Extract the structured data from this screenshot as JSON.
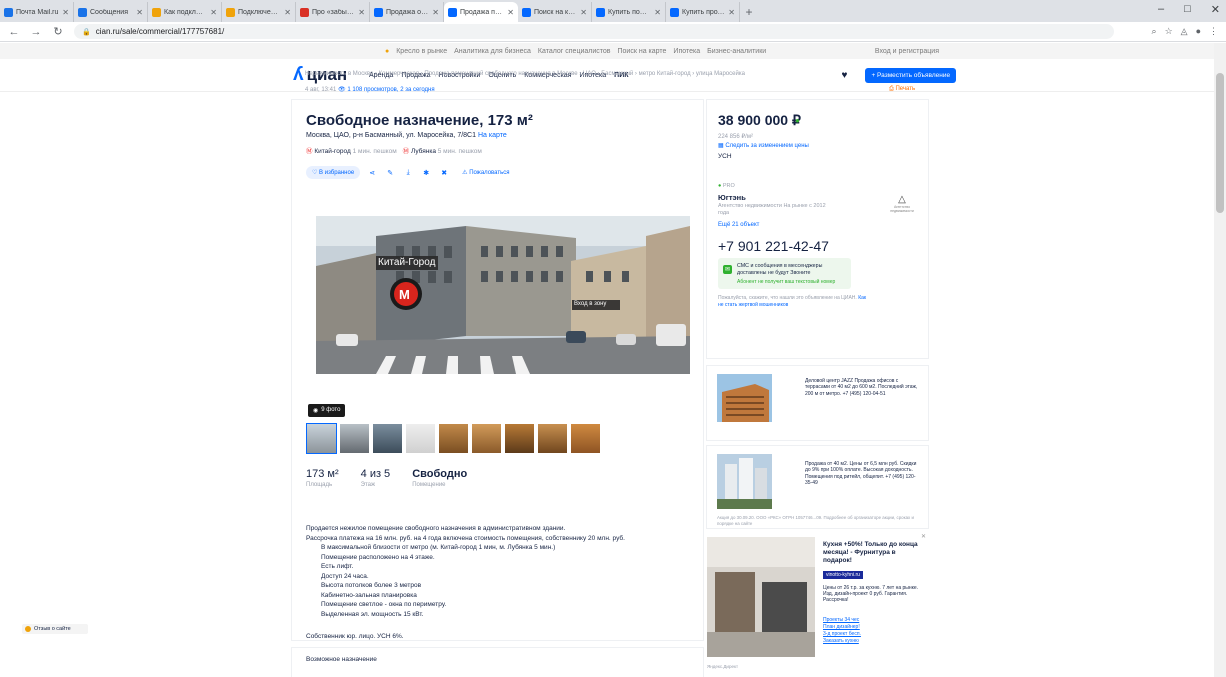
{
  "browser": {
    "tabs": [
      {
        "title": "Почта Mail.ru",
        "color": "#1a73e8"
      },
      {
        "title": "Сообщения",
        "color": "#1a73e8"
      },
      {
        "title": "Как подключить",
        "color": "#f0a30a"
      },
      {
        "title": "Подключение ком",
        "color": "#f0a30a"
      },
      {
        "title": "Про «забытый» на",
        "color": "#d93025"
      },
      {
        "title": "Продажа офиса 2",
        "color": "#0468ff"
      },
      {
        "title": "Продажа помещ",
        "color": "#0468ff",
        "active": true
      },
      {
        "title": "Поиск на карте",
        "color": "#0468ff"
      },
      {
        "title": "Купить помещени",
        "color": "#0468ff"
      },
      {
        "title": "Купить продажа",
        "color": "#0468ff"
      }
    ],
    "url": "cian.ru/sale/commercial/177757681/"
  },
  "topstrip": {
    "links": [
      "Кресло в рынке",
      "Аналитика для бизнеса",
      "Каталог специалистов",
      "Поиск на карте",
      "Ипотека",
      "Бизнес-аналитики"
    ],
    "right": "Вход и регистрация"
  },
  "header": {
    "logo": "циан",
    "nav": [
      "Аренда",
      "Продажа",
      "Новостройки",
      "Оценить",
      "Коммерческая",
      "Ипотека",
      "ПИК"
    ],
    "place_ad": "+ Разместить объявление"
  },
  "breadcrumbs": "Недвижимость в Москве › Коммерческая › Продажа помещений свободного назначения в Москве › ЦАО › Басманный › метро Китай-город › улица Маросейка",
  "meta": {
    "date": "4 авг, 13:41",
    "views": "1 108 просмотров, 2 за сегодня",
    "print": "Печать"
  },
  "listing": {
    "title": "Свободное назначение, 173 м²",
    "address": "Москва, ЦАО, р-н Басманный, ул. Маросейка, 7/8С1",
    "map_link": "На карте",
    "metro": [
      {
        "name": "Китай-город",
        "walk": "1 мин. пешком"
      },
      {
        "name": "Лубянка",
        "walk": "5 мин. пешком"
      }
    ],
    "actions": {
      "favorite": "В избранное",
      "complain": "Пожаловаться"
    },
    "photos_label": "9 фото",
    "photo_sign": "Китай-Город",
    "photo_exit": "Вход в зону",
    "facts": [
      {
        "value": "173 м²",
        "label": "Площадь"
      },
      {
        "value": "4 из 5",
        "label": "Этаж"
      },
      {
        "value": "Свободно",
        "label": "Помещение"
      }
    ],
    "description": [
      "Продается нежилое помещение свободного назначения в административном здании.",
      "Рассрочка платежа на 16 млн. руб. на 4 года включена стоимость помещения, собственнику 20 млн. руб.",
      "В максимальной близости от метро (м. Китай-город 1 мин, м. Лубянка 5 мин.)",
      "Помещение расположено на 4 этаже.",
      "Есть лифт.",
      "Доступ 24 часа.",
      "Высота потолков более 3 метров",
      "Кабинетно-зальная планировка",
      "Помещение светлое - окна по периметру.",
      "Выделенная эл. мощность 15 кВт."
    ],
    "owner": "Собственник юр. лицо. УСН 6%.",
    "section2": "Возможное назначение"
  },
  "price_card": {
    "price": "38 900 000 ₽",
    "per_m2": "224 856 ₽/м²",
    "follow": "Следить за изменением цены",
    "tax": "УСН",
    "pro": "PRO",
    "agency": "Югтэнь",
    "agency_type": "Агентство недвижимости На рынке с 2012 года",
    "all_objects": "Ещё 21 объект",
    "logo_caption": "Агентство недвижимости",
    "phone": "+7 901 221-42-47",
    "sms": "СМС и сообщения в мессенджеры доставлены не будут Звоните",
    "sms_sub": "Абонент не получит ваш текстовый номер",
    "note": "Пожалуйста, скажите, что нашли это объявление на ЦИАН.",
    "note_link": "Как не стать жертвой мошенников"
  },
  "ads": {
    "ad1": "Деловой центр JAZZ Продажа офисов с террасами от 40 м2 до 600 м2. Последний этаж, 200 м от метро. +7 (495) 120-04-51",
    "ad2": "Продажа от 40 м2. Цены от 6,5 млн руб. Скидки до 9% при 100% оплате. Высокая доходность. Помещения под ритейл, общепит. +7 (495) 120-35-49",
    "ad2_legal": "Акция до 30.09.20. ООО «РКС» ОГРН 1057746...09. Подробнее об организаторе акции, сроках и порядке на сайте",
    "ad3_title": "Кухня +50%! Только до конца месяца! - Фурнитура в подарок!",
    "ad3_site": "vinotto-kyhni.ru",
    "ad3_body": "Цены от 26 т.р. за кухню. 7 лет на рынке. Изд, дизайн-проект 0 руб. Гарантия. Рассрочка!",
    "ad3_links": [
      "Проекты 34 чес",
      "План дизайнер!",
      "3-д проект бесп.",
      "Заказать кухню"
    ],
    "ad3_label": "Яндекс.Директ"
  },
  "help": "Отзыв о сайте"
}
